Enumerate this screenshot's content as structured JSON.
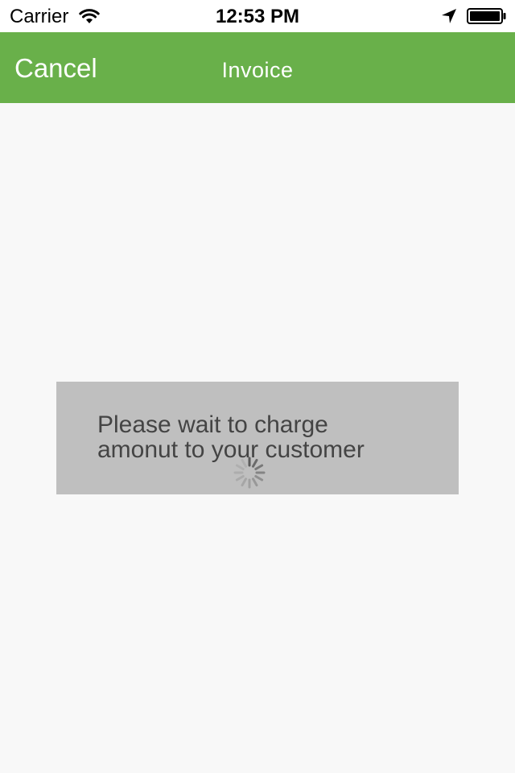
{
  "status_bar": {
    "carrier": "Carrier",
    "time": "12:53 PM",
    "icons": [
      "wifi-icon",
      "location-arrow-icon",
      "battery-icon"
    ]
  },
  "nav_bar": {
    "cancel_label": "Cancel",
    "title": "Invoice",
    "background_color": "#69b04a"
  },
  "loading": {
    "message": "Please wait to charge\namonut to your customer",
    "icon": "spinner-icon",
    "box_color": "#bfbfbf"
  }
}
